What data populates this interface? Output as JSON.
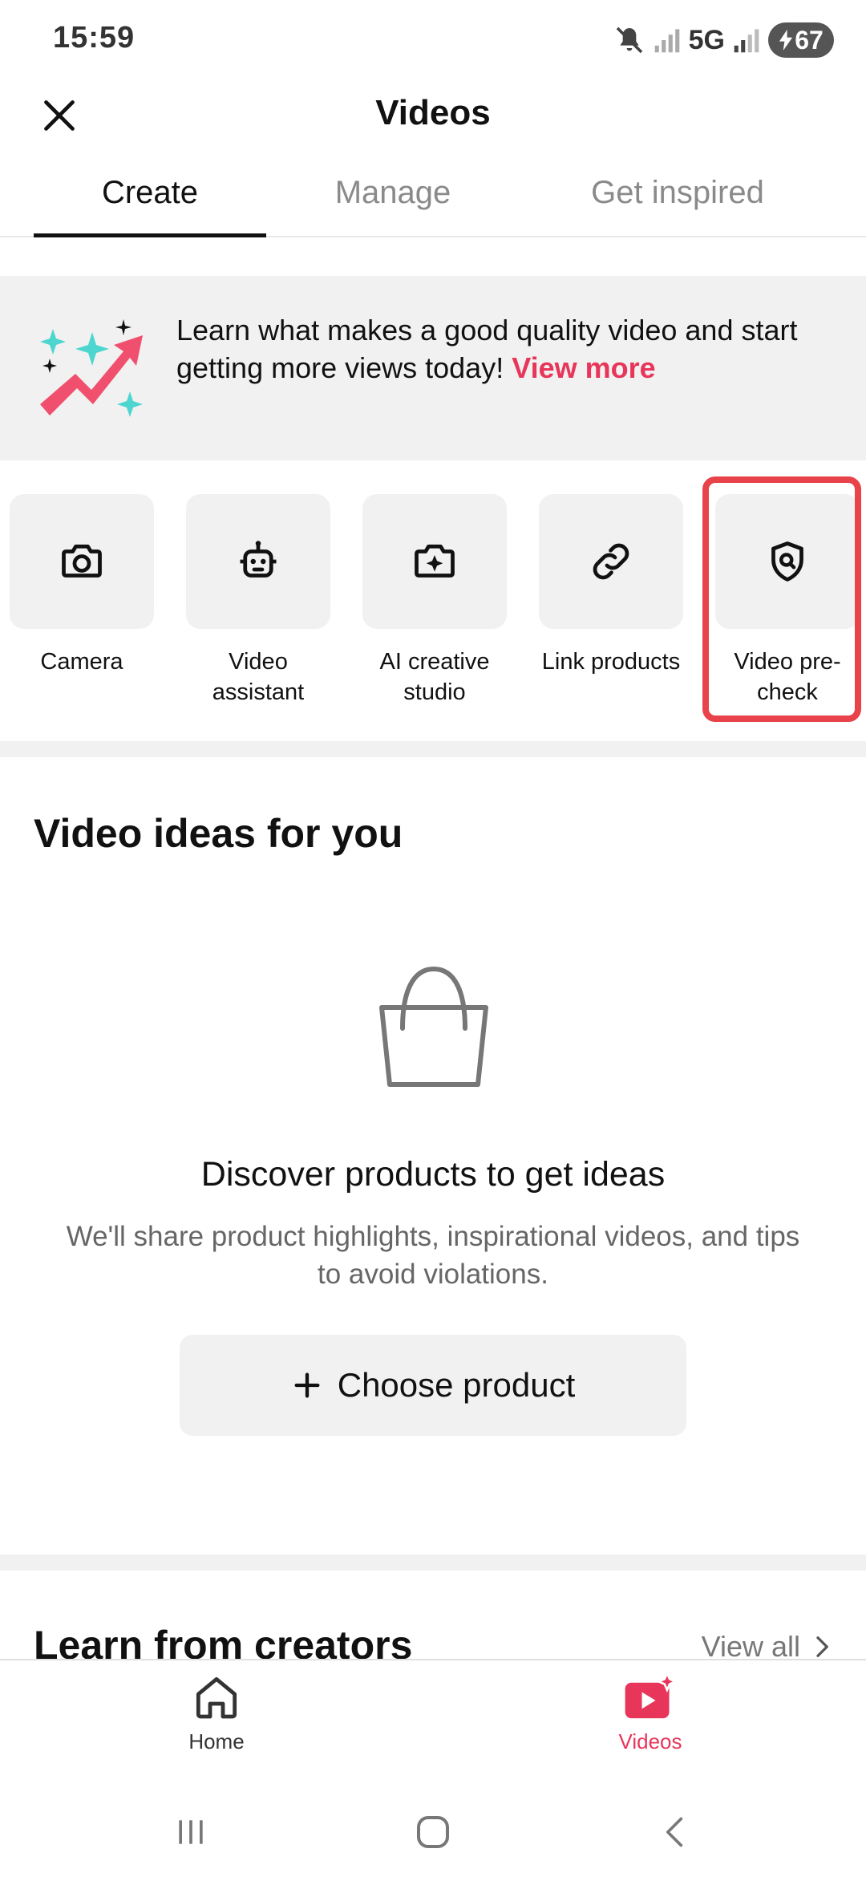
{
  "status": {
    "time": "15:59",
    "network": "5G",
    "battery": "67"
  },
  "header": {
    "title": "Videos"
  },
  "tabs": [
    {
      "label": "Create",
      "active": true
    },
    {
      "label": "Manage",
      "active": false
    },
    {
      "label": "Get inspired",
      "active": false
    }
  ],
  "banner": {
    "text": "Learn what makes a good quality video and start getting more views today!",
    "link": "View more"
  },
  "tools": [
    {
      "label": "Camera",
      "icon": "camera-icon"
    },
    {
      "label": "Video assistant",
      "icon": "robot-icon"
    },
    {
      "label": "AI creative studio",
      "icon": "sparkle-icon"
    },
    {
      "label": "Link products",
      "icon": "link-icon"
    },
    {
      "label": "Video pre-check",
      "icon": "shield-search-icon",
      "highlighted": true
    }
  ],
  "ideas": {
    "title": "Video ideas for you",
    "empty_title": "Discover products to get ideas",
    "empty_subtitle": "We'll share product highlights, inspirational videos, and tips to avoid violations.",
    "button": "Choose product"
  },
  "learn": {
    "title": "Learn from creators",
    "view_all": "View all"
  },
  "bottom_nav": [
    {
      "label": "Home",
      "icon": "home-icon",
      "active": false
    },
    {
      "label": "Videos",
      "icon": "videos-icon",
      "active": true
    }
  ],
  "colors": {
    "accent": "#e8355a",
    "highlight": "#e8434a",
    "surface": "#f1f1f1"
  }
}
